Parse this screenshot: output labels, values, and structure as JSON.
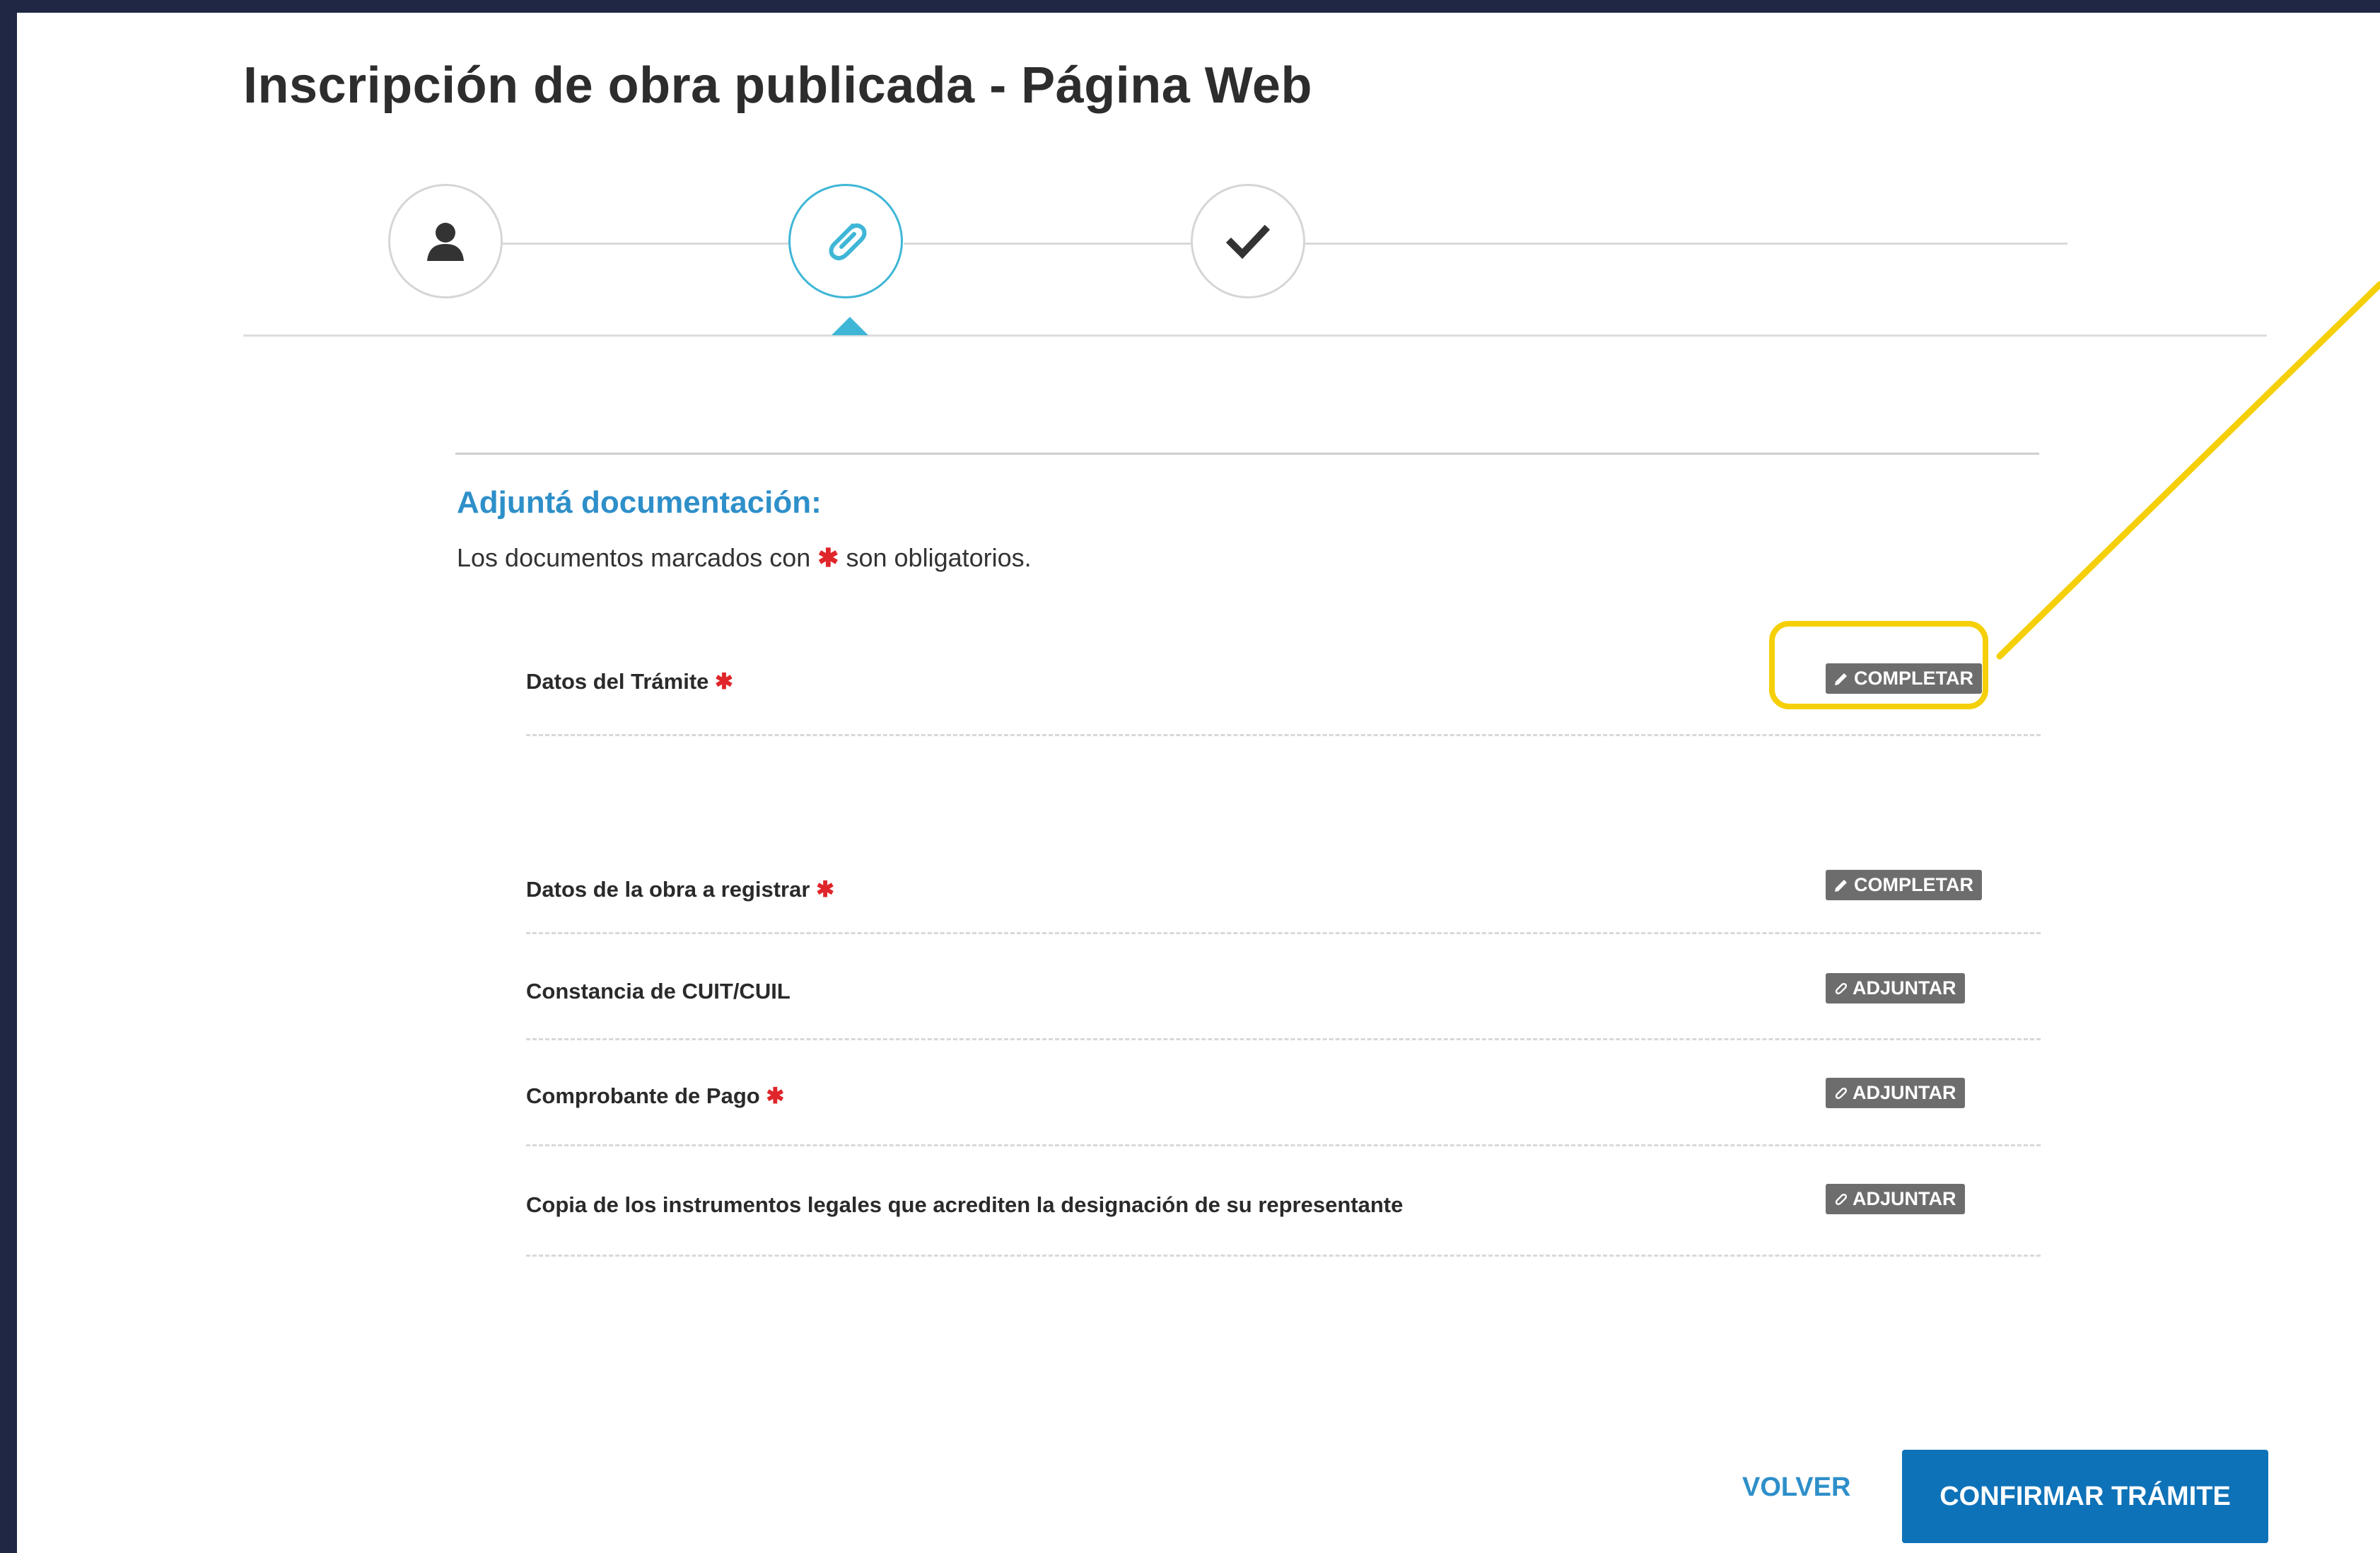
{
  "page": {
    "title": "Inscripción de obra publicada - Página Web"
  },
  "stepper": {
    "steps": [
      {
        "icon": "user-icon",
        "state": "done"
      },
      {
        "icon": "paperclip-icon",
        "state": "active"
      },
      {
        "icon": "check-icon",
        "state": "pending"
      }
    ],
    "accent_color": "#3fb6d6"
  },
  "section": {
    "title": "Adjuntá documentación:",
    "note_before": "Los documentos marcados con",
    "note_asterisk": "✱",
    "note_after": "son obligatorios."
  },
  "documents": [
    {
      "label": "Datos del Trámite",
      "required": true,
      "action": "COMPLETAR",
      "action_icon": "pencil-icon"
    },
    {
      "label": "Datos de la obra a registrar",
      "required": true,
      "action": "COMPLETAR",
      "action_icon": "pencil-icon"
    },
    {
      "label": "Constancia de CUIT/CUIL",
      "required": false,
      "action": "ADJUNTAR",
      "action_icon": "paperclip-icon"
    },
    {
      "label": "Comprobante de Pago",
      "required": true,
      "action": "ADJUNTAR",
      "action_icon": "paperclip-icon"
    },
    {
      "label": "Copia de los instrumentos legales que acrediten la designación de su representante",
      "required": false,
      "action": "ADJUNTAR",
      "action_icon": "paperclip-icon"
    }
  ],
  "required_mark": "✱",
  "footer": {
    "back_label": "VOLVER",
    "confirm_label": "CONFIRMAR TRÁMITE"
  },
  "colors": {
    "frame": "#1f2745",
    "highlight": "#f5cf08",
    "primary": "#0e72b8",
    "link": "#2e8fc9",
    "required": "#e0262b"
  }
}
